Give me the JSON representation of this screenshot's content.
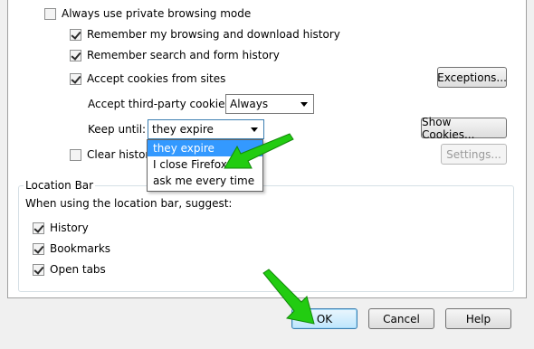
{
  "privacy": {
    "private_mode_label": "Always use private browsing mode",
    "remember_history_label": "Remember my browsing and download history",
    "remember_search_label": "Remember search and form history",
    "accept_cookies_label": "Accept cookies from sites",
    "exceptions_button": "Exceptions...",
    "third_party_label": "Accept third-party cookies:",
    "third_party_value": "Always",
    "keep_until_label": "Keep until:",
    "keep_until_value": "they expire",
    "show_cookies_button": "Show Cookies...",
    "clear_history_label": "Clear history",
    "settings_button": "Settings...",
    "dropdown_options": [
      "they expire",
      "I close Firefox",
      "ask me every time"
    ],
    "dropdown_selected_index": 0
  },
  "location_bar": {
    "group_title": "Location Bar",
    "suggest_label": "When using the location bar, suggest:",
    "history_label": "History",
    "bookmarks_label": "Bookmarks",
    "open_tabs_label": "Open tabs"
  },
  "footer": {
    "ok_button": "OK",
    "cancel_button": "Cancel",
    "help_button": "Help"
  },
  "colors": {
    "annotation_arrow": "#22cc11",
    "selection": "#3399ff"
  }
}
